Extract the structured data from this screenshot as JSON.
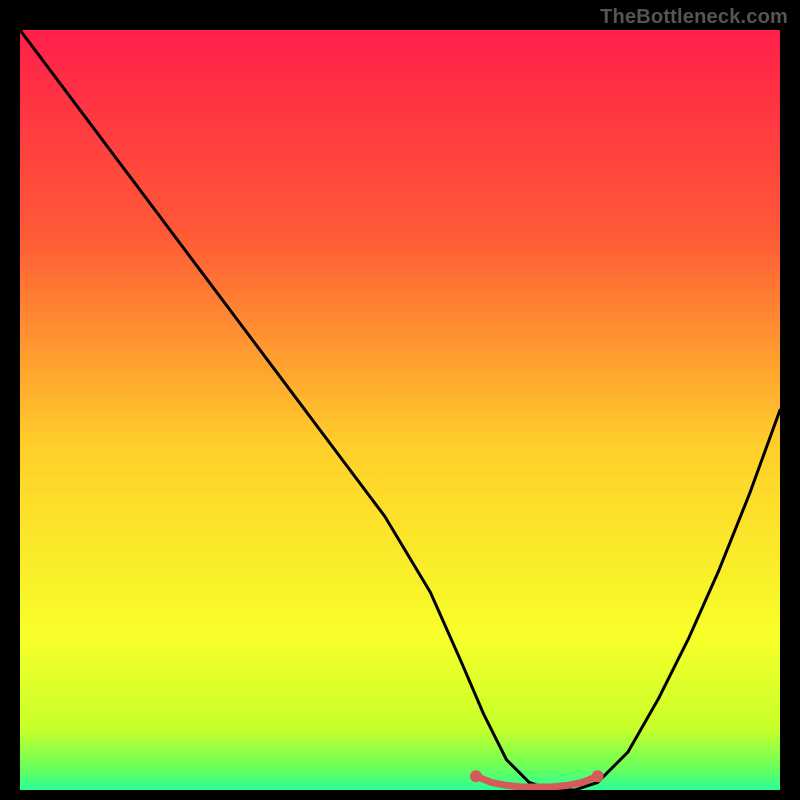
{
  "watermark": "TheBottleneck.com",
  "chart_data": {
    "type": "line",
    "title": "",
    "xlabel": "",
    "ylabel": "",
    "xlim": [
      0,
      100
    ],
    "ylim": [
      0,
      100
    ],
    "grid": false,
    "legend": false,
    "gradient_stops": [
      {
        "offset": 0.0,
        "color": "#ff1f4a"
      },
      {
        "offset": 0.27,
        "color": "#ff5a36"
      },
      {
        "offset": 0.55,
        "color": "#ffd02a"
      },
      {
        "offset": 0.8,
        "color": "#f7ff2a"
      },
      {
        "offset": 0.92,
        "color": "#c6ff2a"
      },
      {
        "offset": 0.97,
        "color": "#6bff5a"
      },
      {
        "offset": 1.0,
        "color": "#2aff98"
      }
    ],
    "series": [
      {
        "name": "bottleneck-curve",
        "stroke": "#000000",
        "x": [
          0,
          6,
          12,
          18,
          24,
          30,
          36,
          42,
          48,
          54,
          58,
          61,
          64,
          67,
          70,
          73,
          76,
          80,
          84,
          88,
          92,
          96,
          100
        ],
        "y": [
          100,
          92,
          84,
          76,
          68,
          60,
          52,
          44,
          36,
          26,
          17,
          10,
          4,
          1,
          0,
          0,
          1,
          5,
          12,
          20,
          29,
          39,
          50
        ]
      },
      {
        "name": "optimal-flat-marker",
        "stroke": "#d55a5a",
        "x": [
          60,
          62,
          64,
          66,
          68,
          70,
          72,
          74,
          76
        ],
        "y": [
          1.8,
          1.0,
          0.6,
          0.4,
          0.4,
          0.4,
          0.6,
          1.0,
          1.8
        ],
        "dots_x": [
          60,
          76
        ],
        "dots_y": [
          1.8,
          1.8
        ]
      }
    ]
  }
}
